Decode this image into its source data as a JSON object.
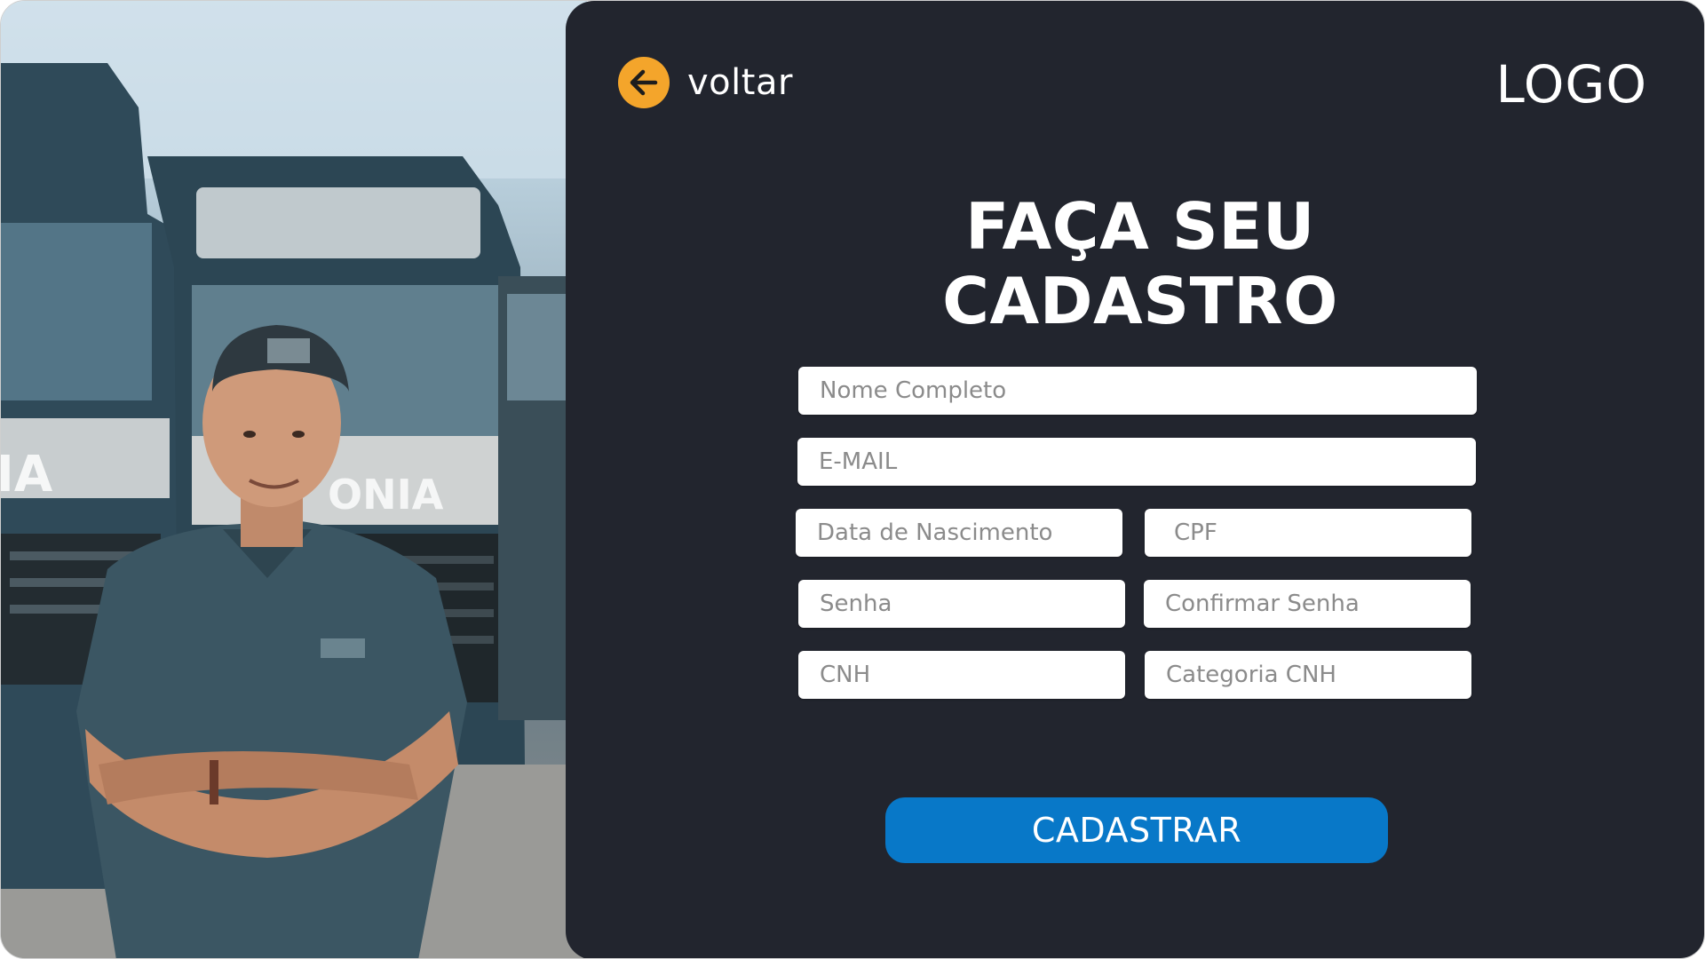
{
  "header": {
    "back_label": "voltar",
    "logo_text": "LOGO"
  },
  "title": "FAÇA SEU CADASTRO",
  "form": {
    "full_name": {
      "value": "",
      "placeholder": "Nome Completo"
    },
    "email": {
      "value": "",
      "placeholder": "E-MAIL"
    },
    "birth_date": {
      "value": "",
      "placeholder": "Data de Nascimento"
    },
    "cpf": {
      "value": "",
      "placeholder": "CPF"
    },
    "password": {
      "value": "",
      "placeholder": "Senha"
    },
    "confirm_password": {
      "value": "",
      "placeholder": "Confirmar Senha"
    },
    "cnh": {
      "value": "",
      "placeholder": "CNH"
    },
    "cnh_category": {
      "value": "",
      "placeholder": "Categoria CNH"
    },
    "submit_label": "CADASTRAR"
  },
  "colors": {
    "panel_background": "#22252e",
    "back_button": "#f4a52b",
    "submit_button": "#0878c8",
    "text": "#ffffff"
  },
  "icons": {
    "back": "arrow-left-icon"
  },
  "image": {
    "subject": "truck-driver-photo"
  }
}
